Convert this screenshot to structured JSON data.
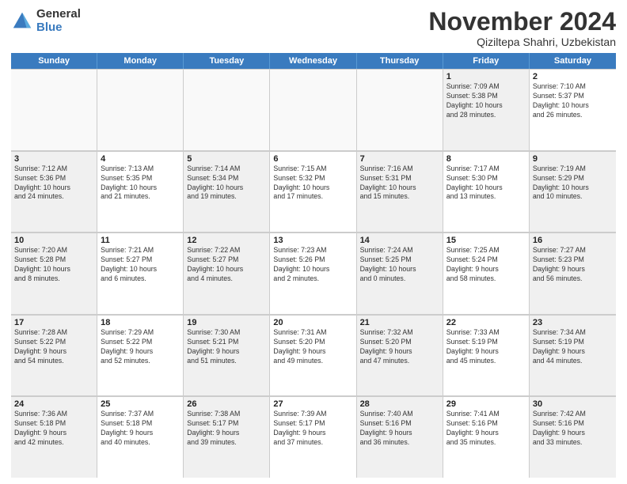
{
  "logo": {
    "general": "General",
    "blue": "Blue"
  },
  "title": "November 2024",
  "subtitle": "Qiziltepa Shahri, Uzbekistan",
  "days": [
    "Sunday",
    "Monday",
    "Tuesday",
    "Wednesday",
    "Thursday",
    "Friday",
    "Saturday"
  ],
  "weeks": [
    [
      {
        "day": "",
        "info": "",
        "empty": true
      },
      {
        "day": "",
        "info": "",
        "empty": true
      },
      {
        "day": "",
        "info": "",
        "empty": true
      },
      {
        "day": "",
        "info": "",
        "empty": true
      },
      {
        "day": "",
        "info": "",
        "empty": true
      },
      {
        "day": "1",
        "info": "Sunrise: 7:09 AM\nSunset: 5:38 PM\nDaylight: 10 hours\nand 28 minutes.",
        "shaded": true
      },
      {
        "day": "2",
        "info": "Sunrise: 7:10 AM\nSunset: 5:37 PM\nDaylight: 10 hours\nand 26 minutes.",
        "shaded": false
      }
    ],
    [
      {
        "day": "3",
        "info": "Sunrise: 7:12 AM\nSunset: 5:36 PM\nDaylight: 10 hours\nand 24 minutes.",
        "shaded": true
      },
      {
        "day": "4",
        "info": "Sunrise: 7:13 AM\nSunset: 5:35 PM\nDaylight: 10 hours\nand 21 minutes.",
        "shaded": false
      },
      {
        "day": "5",
        "info": "Sunrise: 7:14 AM\nSunset: 5:34 PM\nDaylight: 10 hours\nand 19 minutes.",
        "shaded": true
      },
      {
        "day": "6",
        "info": "Sunrise: 7:15 AM\nSunset: 5:32 PM\nDaylight: 10 hours\nand 17 minutes.",
        "shaded": false
      },
      {
        "day": "7",
        "info": "Sunrise: 7:16 AM\nSunset: 5:31 PM\nDaylight: 10 hours\nand 15 minutes.",
        "shaded": true
      },
      {
        "day": "8",
        "info": "Sunrise: 7:17 AM\nSunset: 5:30 PM\nDaylight: 10 hours\nand 13 minutes.",
        "shaded": false
      },
      {
        "day": "9",
        "info": "Sunrise: 7:19 AM\nSunset: 5:29 PM\nDaylight: 10 hours\nand 10 minutes.",
        "shaded": true
      }
    ],
    [
      {
        "day": "10",
        "info": "Sunrise: 7:20 AM\nSunset: 5:28 PM\nDaylight: 10 hours\nand 8 minutes.",
        "shaded": true
      },
      {
        "day": "11",
        "info": "Sunrise: 7:21 AM\nSunset: 5:27 PM\nDaylight: 10 hours\nand 6 minutes.",
        "shaded": false
      },
      {
        "day": "12",
        "info": "Sunrise: 7:22 AM\nSunset: 5:27 PM\nDaylight: 10 hours\nand 4 minutes.",
        "shaded": true
      },
      {
        "day": "13",
        "info": "Sunrise: 7:23 AM\nSunset: 5:26 PM\nDaylight: 10 hours\nand 2 minutes.",
        "shaded": false
      },
      {
        "day": "14",
        "info": "Sunrise: 7:24 AM\nSunset: 5:25 PM\nDaylight: 10 hours\nand 0 minutes.",
        "shaded": true
      },
      {
        "day": "15",
        "info": "Sunrise: 7:25 AM\nSunset: 5:24 PM\nDaylight: 9 hours\nand 58 minutes.",
        "shaded": false
      },
      {
        "day": "16",
        "info": "Sunrise: 7:27 AM\nSunset: 5:23 PM\nDaylight: 9 hours\nand 56 minutes.",
        "shaded": true
      }
    ],
    [
      {
        "day": "17",
        "info": "Sunrise: 7:28 AM\nSunset: 5:22 PM\nDaylight: 9 hours\nand 54 minutes.",
        "shaded": true
      },
      {
        "day": "18",
        "info": "Sunrise: 7:29 AM\nSunset: 5:22 PM\nDaylight: 9 hours\nand 52 minutes.",
        "shaded": false
      },
      {
        "day": "19",
        "info": "Sunrise: 7:30 AM\nSunset: 5:21 PM\nDaylight: 9 hours\nand 51 minutes.",
        "shaded": true
      },
      {
        "day": "20",
        "info": "Sunrise: 7:31 AM\nSunset: 5:20 PM\nDaylight: 9 hours\nand 49 minutes.",
        "shaded": false
      },
      {
        "day": "21",
        "info": "Sunrise: 7:32 AM\nSunset: 5:20 PM\nDaylight: 9 hours\nand 47 minutes.",
        "shaded": true
      },
      {
        "day": "22",
        "info": "Sunrise: 7:33 AM\nSunset: 5:19 PM\nDaylight: 9 hours\nand 45 minutes.",
        "shaded": false
      },
      {
        "day": "23",
        "info": "Sunrise: 7:34 AM\nSunset: 5:19 PM\nDaylight: 9 hours\nand 44 minutes.",
        "shaded": true
      }
    ],
    [
      {
        "day": "24",
        "info": "Sunrise: 7:36 AM\nSunset: 5:18 PM\nDaylight: 9 hours\nand 42 minutes.",
        "shaded": true
      },
      {
        "day": "25",
        "info": "Sunrise: 7:37 AM\nSunset: 5:18 PM\nDaylight: 9 hours\nand 40 minutes.",
        "shaded": false
      },
      {
        "day": "26",
        "info": "Sunrise: 7:38 AM\nSunset: 5:17 PM\nDaylight: 9 hours\nand 39 minutes.",
        "shaded": true
      },
      {
        "day": "27",
        "info": "Sunrise: 7:39 AM\nSunset: 5:17 PM\nDaylight: 9 hours\nand 37 minutes.",
        "shaded": false
      },
      {
        "day": "28",
        "info": "Sunrise: 7:40 AM\nSunset: 5:16 PM\nDaylight: 9 hours\nand 36 minutes.",
        "shaded": true
      },
      {
        "day": "29",
        "info": "Sunrise: 7:41 AM\nSunset: 5:16 PM\nDaylight: 9 hours\nand 35 minutes.",
        "shaded": false
      },
      {
        "day": "30",
        "info": "Sunrise: 7:42 AM\nSunset: 5:16 PM\nDaylight: 9 hours\nand 33 minutes.",
        "shaded": true
      }
    ]
  ]
}
